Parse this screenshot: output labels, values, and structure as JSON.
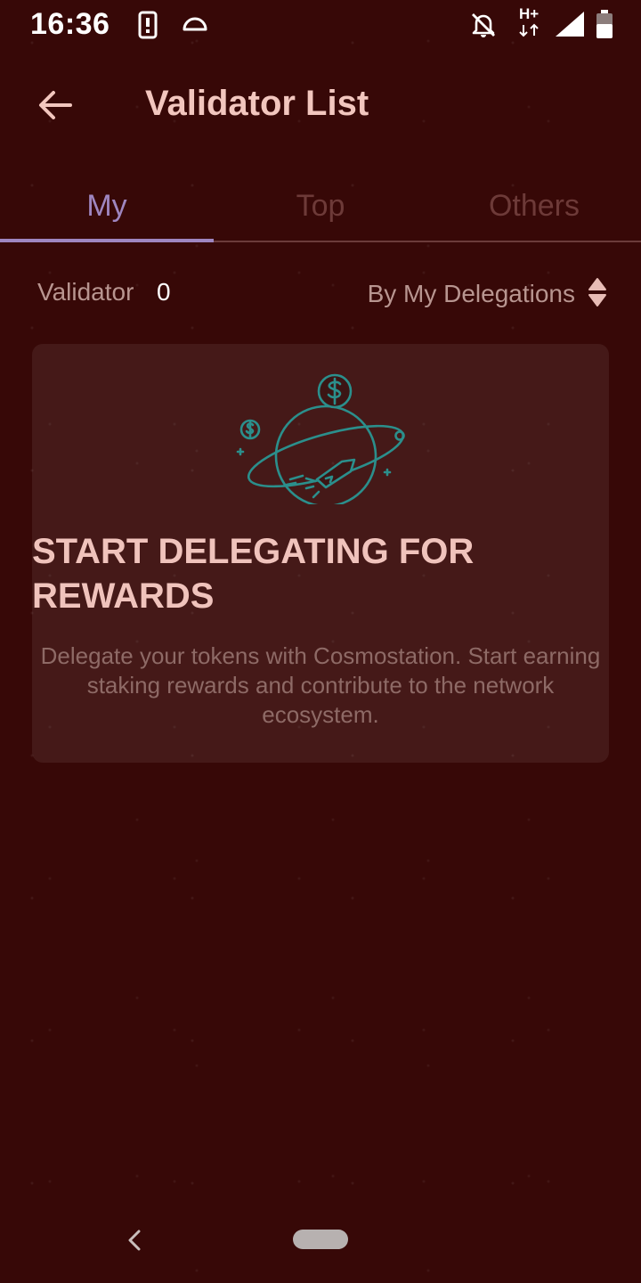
{
  "status_bar": {
    "time": "16:36",
    "network_type": "H+",
    "icons": [
      "phone-icon",
      "arch-icon",
      "bell-off-icon",
      "network-type-icon",
      "signal-icon",
      "battery-icon"
    ]
  },
  "app_bar": {
    "title": "Validator List",
    "back_icon": "arrow-left-icon"
  },
  "tabs": [
    {
      "label": "My",
      "active": true
    },
    {
      "label": "Top",
      "active": false
    },
    {
      "label": "Others",
      "active": false
    }
  ],
  "summary": {
    "validator_label": "Validator",
    "validator_count": "0",
    "sort_label": "By My Delegations",
    "sort_icon": "sort-updown-icon"
  },
  "empty_state": {
    "illustration": "rocket-planet-coin-icon",
    "title": "START DELEGATING FOR REWARDS",
    "description": "Delegate your tokens with Cosmostation. Start earning staking rewards and contribute to the network ecosystem."
  },
  "colors": {
    "background": "#370807",
    "accent": "#9f86c0",
    "illustration": "#2b8f8c",
    "title_text": "#f0c3bc"
  },
  "nav_bar": {
    "back_icon": "nav-back-icon",
    "home_icon": "nav-home-pill-icon"
  }
}
